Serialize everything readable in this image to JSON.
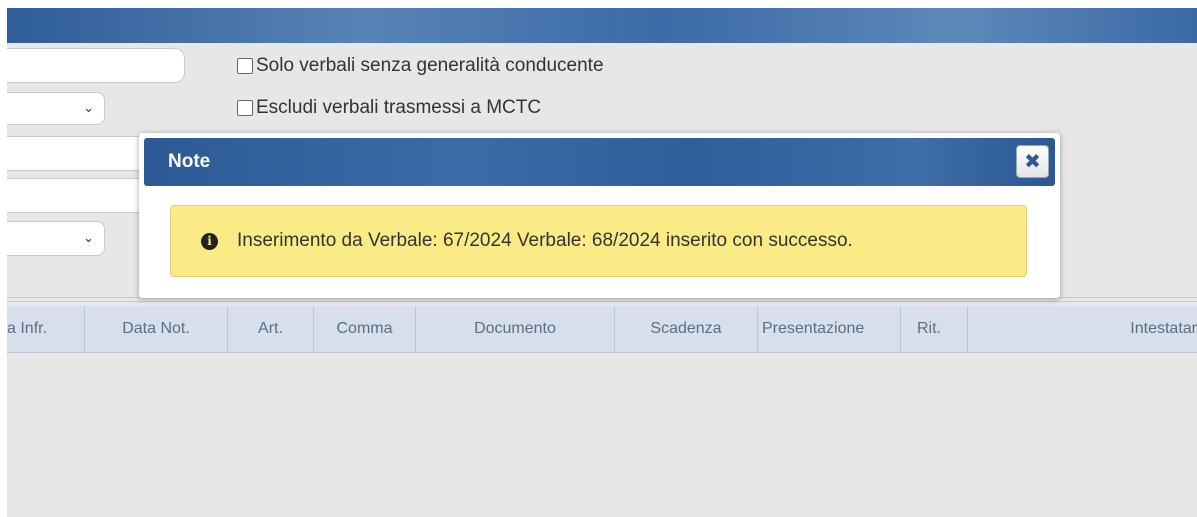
{
  "filters": {
    "checkbox_no_driver": "Solo verbali senza generalità conducente",
    "checkbox_exclude_mctc": "Escludi verbali trasmessi a MCTC",
    "select_arrow_1": "⌄",
    "select_arrow_2": "⌄"
  },
  "grid": {
    "columns": [
      "a Infr.",
      "Data Not.",
      "Art.",
      "Comma",
      "Documento",
      "Scadenza",
      "Presentazione",
      "Rit.",
      "Intestatar"
    ]
  },
  "dialog": {
    "title": "Note",
    "close_glyph": "✖",
    "info_glyph": "i",
    "message": "Inserimento da Verbale: 67/2024 Verbale: 68/2024 inserito con successo."
  }
}
